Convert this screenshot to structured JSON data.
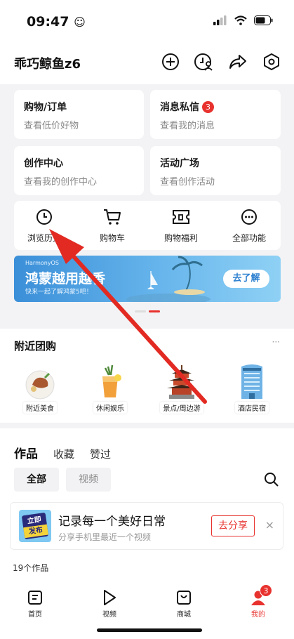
{
  "status_bar": {
    "time": "09:47",
    "emoji": "☺"
  },
  "profile": {
    "username": "乖巧鲸鱼z6"
  },
  "cards": [
    {
      "title": "购物/订单",
      "subtitle": "查看低价好物"
    },
    {
      "title": "消息私信",
      "subtitle": "查看我的消息",
      "badge": "3"
    },
    {
      "title": "创作中心",
      "subtitle": "查看我的创作中心"
    },
    {
      "title": "活动广场",
      "subtitle": "查看创作活动"
    }
  ],
  "quick_actions": [
    {
      "label": "浏览历史",
      "icon": "clock-icon"
    },
    {
      "label": "购物车",
      "icon": "cart-icon"
    },
    {
      "label": "购物福利",
      "icon": "ticket-icon"
    },
    {
      "label": "全部功能",
      "icon": "more-icon"
    }
  ],
  "banner": {
    "small": "HarmonyOS",
    "title": "鸿蒙越用越香",
    "subtitle": "快来一起了解鸿蒙5吧！",
    "button": "去了解"
  },
  "nearby": {
    "title": "附近团购",
    "more": "···",
    "items": [
      {
        "label": "附近美食",
        "icon": "food-plate-icon"
      },
      {
        "label": "休闲娱乐",
        "icon": "cocktail-icon"
      },
      {
        "label": "景点/周边游",
        "icon": "pagoda-icon"
      },
      {
        "label": "酒店民宿",
        "icon": "hotel-building-icon"
      }
    ]
  },
  "works": {
    "tabs": [
      "作品",
      "收藏",
      "赞过"
    ],
    "filters": [
      "全部",
      "视频"
    ],
    "share": {
      "title": "记录每一个美好日常",
      "subtitle": "分享手机里最近一个视频",
      "button": "去分享",
      "close": "×",
      "sticker_lines": [
        "立即",
        "发布"
      ]
    },
    "count": "19个作品"
  },
  "tab_bar": [
    {
      "label": "首页",
      "icon": "home-doc-icon"
    },
    {
      "label": "视频",
      "icon": "play-icon"
    },
    {
      "label": "商城",
      "icon": "shop-bag-icon"
    },
    {
      "label": "我的",
      "icon": "person-icon",
      "badge": "3",
      "active": true
    }
  ],
  "colors": {
    "accent_red": "#e8322e",
    "banner_blue": "#3b8fd8",
    "background_gray": "#f3f3f5"
  }
}
